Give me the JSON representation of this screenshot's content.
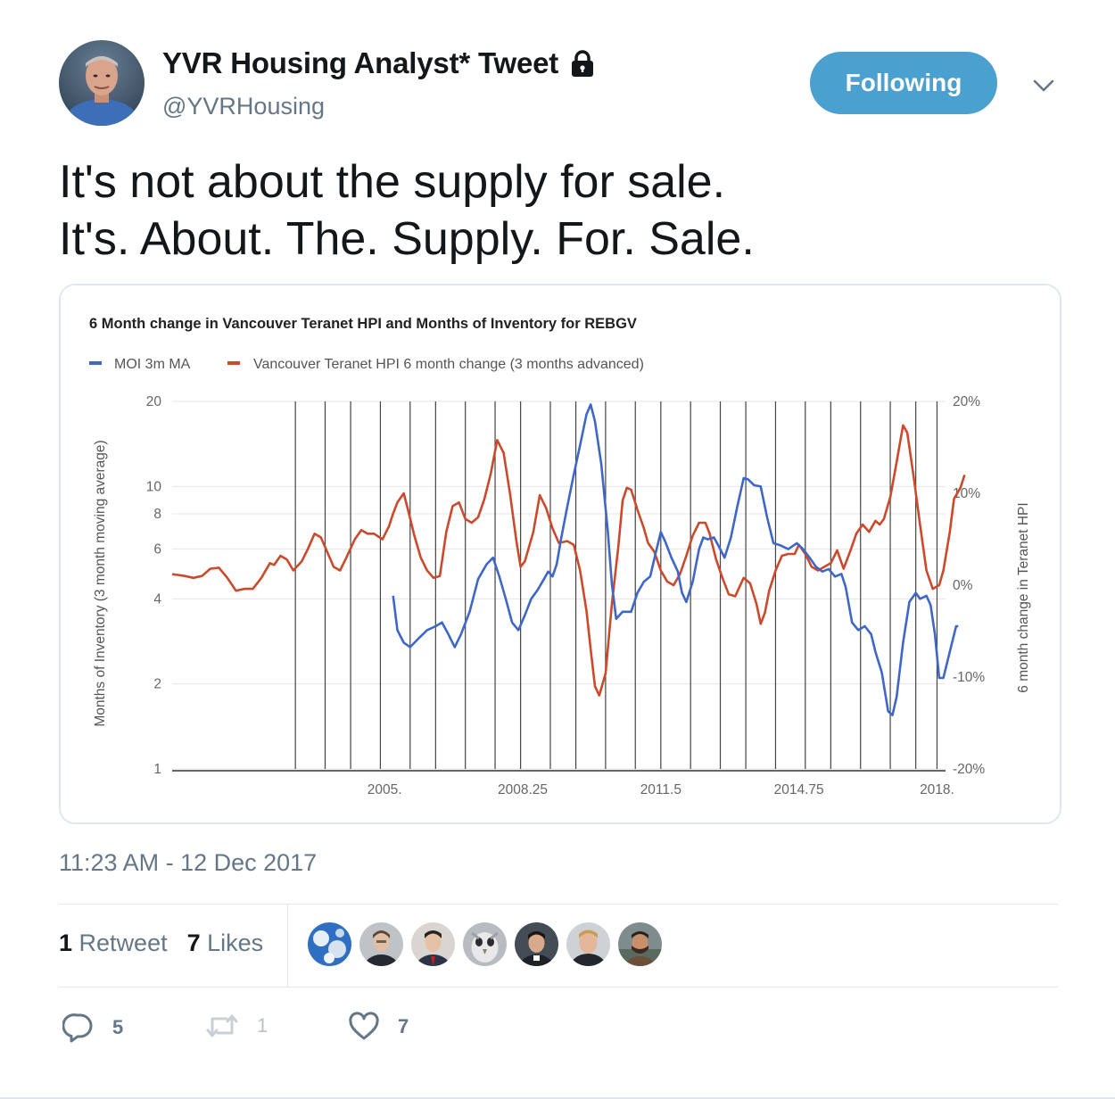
{
  "header": {
    "display_name": "YVR Housing Analyst* Tweet",
    "handle": "@YVRHousing",
    "follow_label": "Following",
    "protected_icon": "lock-icon",
    "menu_icon": "chevron-down-icon"
  },
  "tweet": {
    "line1": "It's not about the supply for sale.",
    "line2": "It's. About. The. Supply. For. Sale.",
    "timestamp": "11:23 AM - 12 Dec 2017"
  },
  "stats": {
    "retweets_count": "1",
    "retweets_label": "Retweet",
    "likes_count": "7",
    "likes_label": "Likes"
  },
  "actions": {
    "reply_count": "5",
    "retweet_count": "1",
    "like_count": "7"
  },
  "colors": {
    "accent": "#4aa1d0",
    "moi_series": "#3f67c7",
    "hpi_series": "#cc4a2c"
  },
  "chart_data": {
    "type": "line",
    "title": "6 Month change in Vancouver Teranet HPI and Months of Inventory for REBGV",
    "ylabel": "Months of Inventory (3 month moving average)",
    "y2label": "6 month change in Teranet HPI",
    "yscale": "log",
    "ylim": [
      1,
      20
    ],
    "y2lim": [
      -20,
      20
    ],
    "xlim": [
      2000,
      2018.2
    ],
    "y_ticks": [
      "20",
      "10",
      "8",
      "6",
      "4",
      "2",
      "1"
    ],
    "y_tick_values": [
      20,
      10,
      8,
      6,
      4,
      2,
      1
    ],
    "y2_ticks": [
      "20%",
      "10%",
      "0%",
      "-10%",
      "-20%"
    ],
    "y2_tick_values": [
      20,
      10,
      0,
      -10,
      -20
    ],
    "x_ticks": [
      "2005.",
      "2008.25",
      "2011.5",
      "2014.75",
      "2018."
    ],
    "x_tick_values": [
      2005,
      2008.25,
      2011.5,
      2014.75,
      2018
    ],
    "vertical_gridlines": [
      2002.9,
      2003.6,
      2004.2,
      2004.9,
      2005.6,
      2006.2,
      2006.9,
      2007.6,
      2008.2,
      2008.9,
      2009.5,
      2010.2,
      2010.9,
      2011.5,
      2012.2,
      2012.9,
      2013.5,
      2014.2,
      2014.9,
      2015.5,
      2016.2,
      2016.9,
      2017.5,
      2018.0
    ],
    "legend_position": "top-left",
    "series": [
      {
        "name": "MOI 3m MA",
        "axis": "left",
        "points": [
          [
            2005.2,
            4.1
          ],
          [
            2005.3,
            3.1
          ],
          [
            2005.45,
            2.8
          ],
          [
            2005.6,
            2.7
          ],
          [
            2005.8,
            2.9
          ],
          [
            2006.0,
            3.1
          ],
          [
            2006.2,
            3.2
          ],
          [
            2006.35,
            3.3
          ],
          [
            2006.5,
            3.0
          ],
          [
            2006.65,
            2.7
          ],
          [
            2006.8,
            3.0
          ],
          [
            2007.0,
            3.6
          ],
          [
            2007.2,
            4.7
          ],
          [
            2007.4,
            5.3
          ],
          [
            2007.55,
            5.6
          ],
          [
            2007.7,
            4.8
          ],
          [
            2007.85,
            4.0
          ],
          [
            2008.0,
            3.3
          ],
          [
            2008.15,
            3.1
          ],
          [
            2008.3,
            3.5
          ],
          [
            2008.45,
            4.0
          ],
          [
            2008.6,
            4.3
          ],
          [
            2008.75,
            4.7
          ],
          [
            2008.85,
            5.0
          ],
          [
            2008.95,
            4.8
          ],
          [
            2009.05,
            5.3
          ],
          [
            2009.15,
            6.5
          ],
          [
            2009.3,
            8.5
          ],
          [
            2009.45,
            11
          ],
          [
            2009.6,
            14
          ],
          [
            2009.75,
            18
          ],
          [
            2009.85,
            19.5
          ],
          [
            2009.95,
            17
          ],
          [
            2010.1,
            12
          ],
          [
            2010.25,
            7
          ],
          [
            2010.35,
            4.5
          ],
          [
            2010.45,
            3.4
          ],
          [
            2010.6,
            3.6
          ],
          [
            2010.8,
            3.6
          ],
          [
            2010.95,
            4.2
          ],
          [
            2011.1,
            4.6
          ],
          [
            2011.25,
            4.8
          ],
          [
            2011.4,
            6.0
          ],
          [
            2011.5,
            6.9
          ],
          [
            2011.6,
            6.4
          ],
          [
            2011.75,
            5.6
          ],
          [
            2011.9,
            5.0
          ],
          [
            2012.0,
            4.2
          ],
          [
            2012.1,
            3.9
          ],
          [
            2012.25,
            4.6
          ],
          [
            2012.4,
            6.0
          ],
          [
            2012.5,
            6.6
          ],
          [
            2012.6,
            6.5
          ],
          [
            2012.75,
            6.6
          ],
          [
            2012.85,
            6.2
          ],
          [
            2013.0,
            5.6
          ],
          [
            2013.15,
            6.6
          ],
          [
            2013.3,
            8.5
          ],
          [
            2013.45,
            10.7
          ],
          [
            2013.55,
            10.6
          ],
          [
            2013.7,
            10.1
          ],
          [
            2013.85,
            10.0
          ],
          [
            2014.0,
            7.8
          ],
          [
            2014.15,
            6.3
          ],
          [
            2014.3,
            6.2
          ],
          [
            2014.5,
            6.0
          ],
          [
            2014.7,
            6.3
          ],
          [
            2014.85,
            6.0
          ],
          [
            2015.0,
            5.6
          ],
          [
            2015.15,
            5.2
          ],
          [
            2015.3,
            5.0
          ],
          [
            2015.45,
            5.1
          ],
          [
            2015.6,
            4.8
          ],
          [
            2015.75,
            4.9
          ],
          [
            2015.85,
            4.4
          ],
          [
            2016.0,
            3.3
          ],
          [
            2016.15,
            3.1
          ],
          [
            2016.3,
            3.2
          ],
          [
            2016.45,
            3.0
          ],
          [
            2016.55,
            2.6
          ],
          [
            2016.7,
            2.2
          ],
          [
            2016.85,
            1.6
          ],
          [
            2016.95,
            1.55
          ],
          [
            2017.05,
            1.8
          ],
          [
            2017.2,
            2.8
          ],
          [
            2017.35,
            3.9
          ],
          [
            2017.5,
            4.2
          ],
          [
            2017.6,
            4.0
          ],
          [
            2017.75,
            4.1
          ],
          [
            2017.85,
            3.8
          ],
          [
            2017.95,
            3.0
          ],
          [
            2018.05,
            2.1
          ],
          [
            2018.15,
            2.1
          ],
          [
            2018.3,
            2.6
          ],
          [
            2018.45,
            3.2
          ],
          [
            2018.5,
            3.2
          ]
        ]
      },
      {
        "name": "Vancouver Teranet HPI 6 month change (3 months advanced)",
        "axis": "right",
        "points": [
          [
            2000.0,
            1.2
          ],
          [
            2000.3,
            1.0
          ],
          [
            2000.5,
            0.8
          ],
          [
            2000.7,
            1.0
          ],
          [
            2000.9,
            1.8
          ],
          [
            2001.1,
            1.9
          ],
          [
            2001.3,
            0.8
          ],
          [
            2001.5,
            -0.6
          ],
          [
            2001.7,
            -0.4
          ],
          [
            2001.9,
            -0.4
          ],
          [
            2002.1,
            0.8
          ],
          [
            2002.3,
            2.4
          ],
          [
            2002.4,
            2.2
          ],
          [
            2002.55,
            3.2
          ],
          [
            2002.7,
            2.8
          ],
          [
            2002.85,
            1.6
          ],
          [
            2003.05,
            2.6
          ],
          [
            2003.2,
            4.0
          ],
          [
            2003.35,
            5.6
          ],
          [
            2003.5,
            5.2
          ],
          [
            2003.65,
            3.6
          ],
          [
            2003.8,
            2.0
          ],
          [
            2003.95,
            1.6
          ],
          [
            2004.1,
            3.0
          ],
          [
            2004.3,
            5.0
          ],
          [
            2004.45,
            6.0
          ],
          [
            2004.6,
            5.6
          ],
          [
            2004.75,
            5.6
          ],
          [
            2004.95,
            5.0
          ],
          [
            2005.1,
            6.4
          ],
          [
            2005.2,
            7.8
          ],
          [
            2005.3,
            9.0
          ],
          [
            2005.45,
            10.0
          ],
          [
            2005.55,
            8.2
          ],
          [
            2005.7,
            5.4
          ],
          [
            2005.85,
            3.0
          ],
          [
            2006.0,
            1.6
          ],
          [
            2006.15,
            0.8
          ],
          [
            2006.3,
            1.0
          ],
          [
            2006.45,
            5.8
          ],
          [
            2006.6,
            8.6
          ],
          [
            2006.75,
            9.0
          ],
          [
            2006.9,
            7.2
          ],
          [
            2007.05,
            6.8
          ],
          [
            2007.2,
            7.4
          ],
          [
            2007.35,
            9.4
          ],
          [
            2007.5,
            12.2
          ],
          [
            2007.65,
            15.8
          ],
          [
            2007.8,
            14.4
          ],
          [
            2007.95,
            10.0
          ],
          [
            2008.1,
            4.8
          ],
          [
            2008.2,
            2.0
          ],
          [
            2008.3,
            2.6
          ],
          [
            2008.5,
            5.8
          ],
          [
            2008.65,
            9.8
          ],
          [
            2008.8,
            8.4
          ],
          [
            2008.95,
            6.2
          ],
          [
            2009.1,
            4.6
          ],
          [
            2009.3,
            4.8
          ],
          [
            2009.45,
            4.4
          ],
          [
            2009.6,
            1.6
          ],
          [
            2009.75,
            -2.8
          ],
          [
            2009.85,
            -7.0
          ],
          [
            2009.95,
            -11.0
          ],
          [
            2010.05,
            -12.0
          ],
          [
            2010.2,
            -9.6
          ],
          [
            2010.35,
            -2.0
          ],
          [
            2010.5,
            4.2
          ],
          [
            2010.6,
            9.2
          ],
          [
            2010.7,
            10.6
          ],
          [
            2010.8,
            10.4
          ],
          [
            2010.95,
            8.2
          ],
          [
            2011.1,
            6.2
          ],
          [
            2011.2,
            4.6
          ],
          [
            2011.35,
            3.6
          ],
          [
            2011.5,
            1.6
          ],
          [
            2011.65,
            0.4
          ],
          [
            2011.8,
            0.0
          ],
          [
            2011.95,
            1.2
          ],
          [
            2012.1,
            3.2
          ],
          [
            2012.25,
            5.4
          ],
          [
            2012.4,
            6.8
          ],
          [
            2012.55,
            6.8
          ],
          [
            2012.65,
            5.6
          ],
          [
            2012.8,
            2.8
          ],
          [
            2012.95,
            0.8
          ],
          [
            2013.1,
            -1.0
          ],
          [
            2013.25,
            -1.2
          ],
          [
            2013.45,
            0.8
          ],
          [
            2013.6,
            0.2
          ],
          [
            2013.75,
            -2.0
          ],
          [
            2013.85,
            -4.2
          ],
          [
            2013.95,
            -3.0
          ],
          [
            2014.05,
            -0.6
          ],
          [
            2014.2,
            1.6
          ],
          [
            2014.35,
            3.2
          ],
          [
            2014.5,
            3.4
          ],
          [
            2014.65,
            3.4
          ],
          [
            2014.75,
            4.4
          ],
          [
            2014.9,
            3.4
          ],
          [
            2015.05,
            2.0
          ],
          [
            2015.2,
            1.6
          ],
          [
            2015.35,
            2.0
          ],
          [
            2015.5,
            2.4
          ],
          [
            2015.65,
            3.8
          ],
          [
            2015.8,
            1.8
          ],
          [
            2015.95,
            3.6
          ],
          [
            2016.1,
            5.6
          ],
          [
            2016.25,
            6.6
          ],
          [
            2016.4,
            5.8
          ],
          [
            2016.55,
            7.0
          ],
          [
            2016.65,
            6.6
          ],
          [
            2016.75,
            7.2
          ],
          [
            2016.9,
            9.6
          ],
          [
            2017.05,
            13.4
          ],
          [
            2017.2,
            17.4
          ],
          [
            2017.3,
            16.6
          ],
          [
            2017.45,
            11.8
          ],
          [
            2017.6,
            6.6
          ],
          [
            2017.75,
            1.6
          ],
          [
            2017.9,
            -0.4
          ],
          [
            2018.05,
            0.0
          ],
          [
            2018.15,
            1.6
          ],
          [
            2018.3,
            5.8
          ],
          [
            2018.4,
            9.4
          ],
          [
            2018.55,
            10.6
          ],
          [
            2018.65,
            12.0
          ]
        ]
      }
    ]
  }
}
